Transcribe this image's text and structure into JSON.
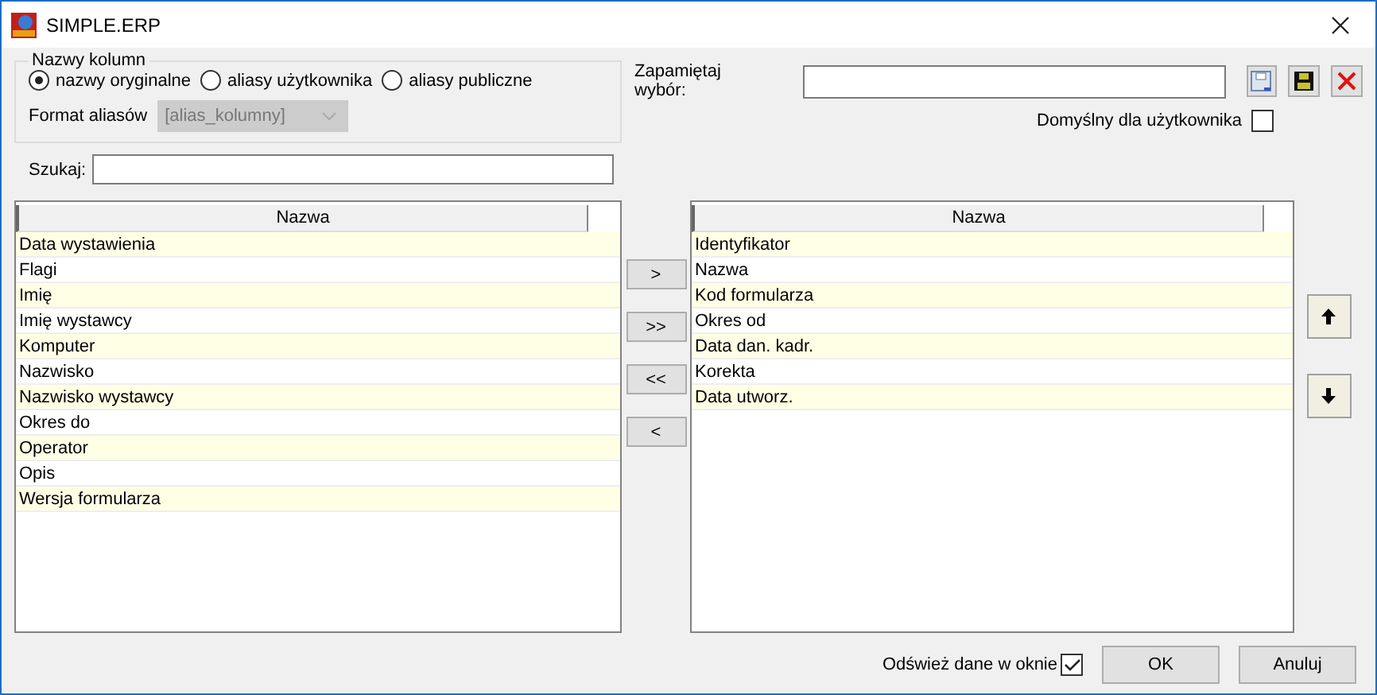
{
  "window": {
    "title": "SIMPLE.ERP"
  },
  "column_names": {
    "legend": "Nazwy kolumn",
    "options": [
      {
        "label": "nazwy oryginalne",
        "selected": true
      },
      {
        "label": "aliasy użytkownika",
        "selected": false
      },
      {
        "label": "aliasy publiczne",
        "selected": false
      }
    ],
    "alias_format": {
      "label": "Format aliasów",
      "value": "[alias_kolumny]",
      "disabled": true
    }
  },
  "search": {
    "label": "Szukaj:"
  },
  "remember": {
    "label": "Zapamiętaj wybór:",
    "default_label": "Domyślny dla użytkownika",
    "default_checked": false
  },
  "available": {
    "header": "Nazwa",
    "rows": [
      "Data wystawienia",
      "Flagi",
      "Imię",
      "Imię wystawcy",
      "Komputer",
      "Nazwisko",
      "Nazwisko wystawcy",
      "Okres do",
      "Operator",
      "Opis",
      "Wersja formularza"
    ]
  },
  "move_buttons": [
    ">",
    ">>",
    "<<",
    "<"
  ],
  "chosen": {
    "header": "Nazwa",
    "rows": [
      "Identyfikator",
      "Nazwa",
      "Kod formularza",
      "Okres od",
      "Data dan. kadr.",
      "Korekta",
      "Data utworz."
    ]
  },
  "refresh": {
    "label": "Odśwież dane w oknie",
    "checked": true
  },
  "buttons": [
    "OK",
    "Anuluj"
  ]
}
